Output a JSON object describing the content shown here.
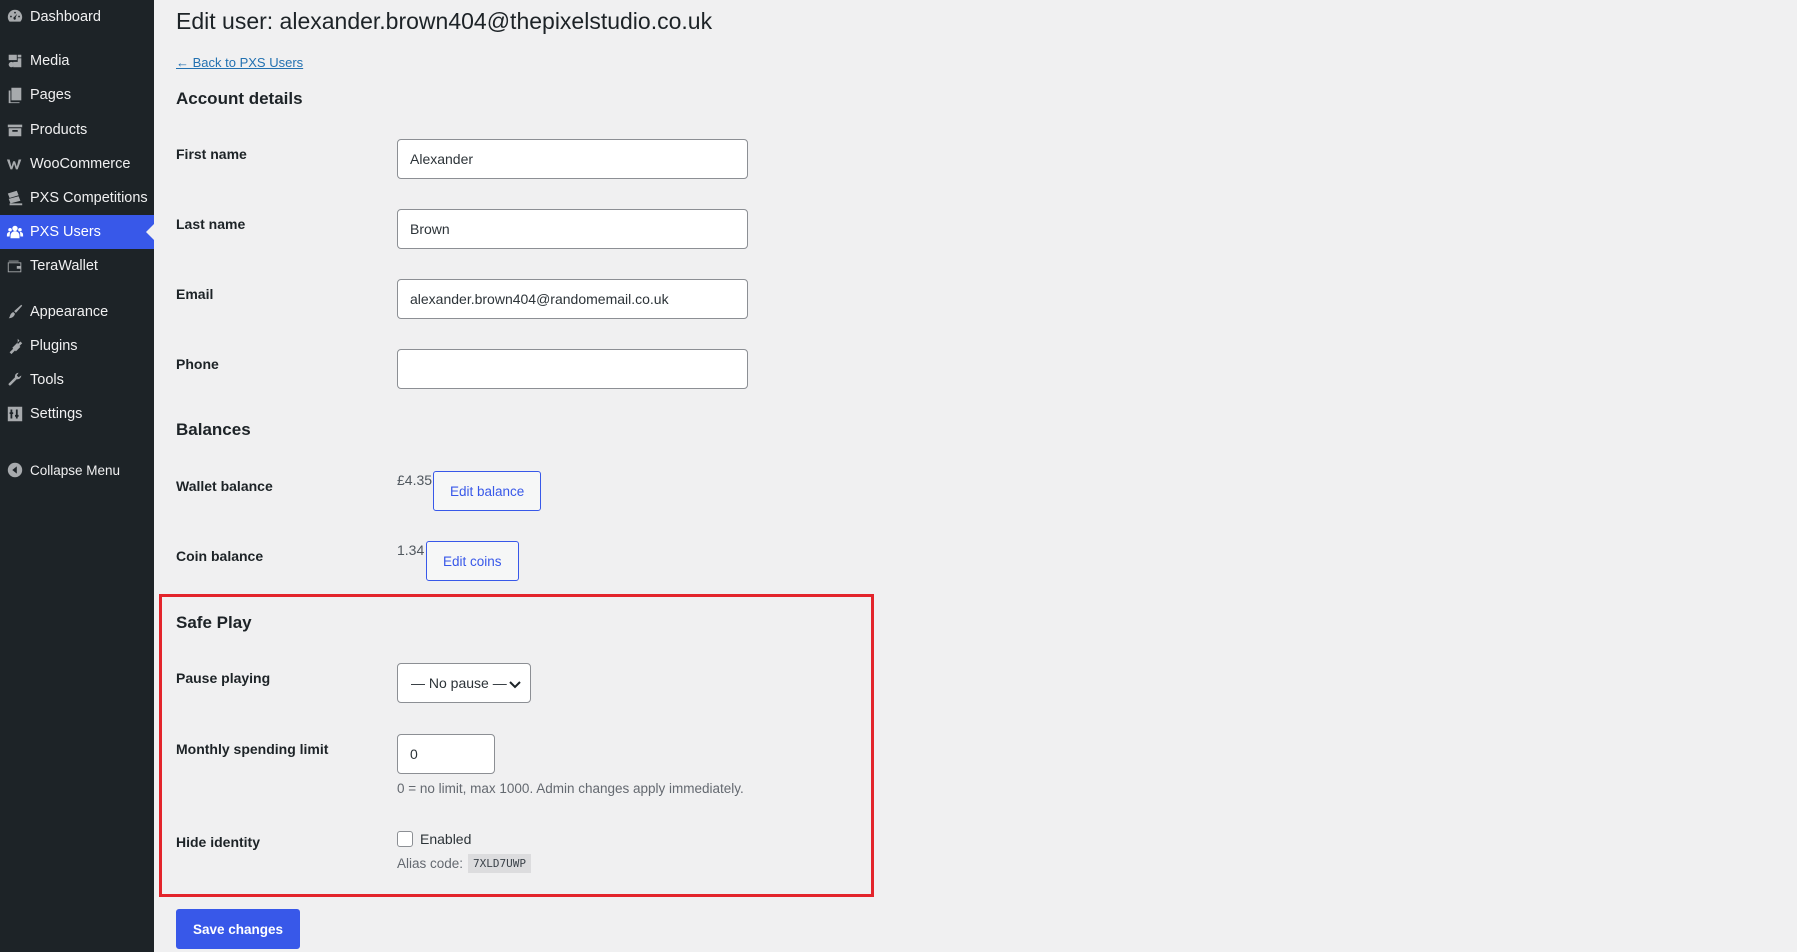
{
  "sidebar": {
    "items": [
      {
        "label": "Dashboard",
        "icon": "dashboard-icon"
      },
      {
        "label": "Media",
        "icon": "media-icon"
      },
      {
        "label": "Pages",
        "icon": "pages-icon"
      },
      {
        "label": "Products",
        "icon": "products-icon"
      },
      {
        "label": "WooCommerce",
        "icon": "woocommerce-icon"
      },
      {
        "label": "PXS Competitions",
        "icon": "tickets-icon"
      },
      {
        "label": "PXS Users",
        "icon": "users-icon",
        "active": true
      },
      {
        "label": "TeraWallet",
        "icon": "wallet-icon"
      },
      {
        "label": "Appearance",
        "icon": "paintbrush-icon"
      },
      {
        "label": "Plugins",
        "icon": "plugin-icon"
      },
      {
        "label": "Tools",
        "icon": "wrench-icon"
      },
      {
        "label": "Settings",
        "icon": "settings-icon"
      },
      {
        "label": "Collapse Menu",
        "icon": "collapse-icon"
      }
    ]
  },
  "page": {
    "title": "Edit user: alexander.brown404@thepixelstudio.co.uk",
    "back_link": "← Back to PXS Users"
  },
  "account": {
    "title": "Account details",
    "first_name_label": "First name",
    "first_name_value": "Alexander",
    "last_name_label": "Last name",
    "last_name_value": "Brown",
    "email_label": "Email",
    "email_value": "alexander.brown404@randomemail.co.uk",
    "phone_label": "Phone",
    "phone_value": ""
  },
  "balances": {
    "title": "Balances",
    "wallet_label": "Wallet balance",
    "wallet_value": "£4.35",
    "edit_balance_label": "Edit balance",
    "coin_label": "Coin balance",
    "coin_value": "1.34",
    "edit_coins_label": "Edit coins"
  },
  "safe_play": {
    "title": "Safe Play",
    "pause_label": "Pause playing",
    "pause_selected": "— No pause —",
    "limit_label": "Monthly spending limit",
    "limit_value": "0",
    "limit_help": "0 = no limit, max 1000. Admin changes apply immediately.",
    "hide_label": "Hide identity",
    "enabled_label": "Enabled",
    "enabled_checked": false,
    "alias_label": "Alias code:",
    "alias_code": "7XLD7UWP",
    "highlight_color": "#e3242b"
  },
  "actions": {
    "save_label": "Save changes"
  },
  "colors": {
    "sidebar_bg": "#1d2327",
    "active_bg": "#3858e9",
    "page_bg": "#f0f0f1",
    "link": "#2271b1"
  }
}
